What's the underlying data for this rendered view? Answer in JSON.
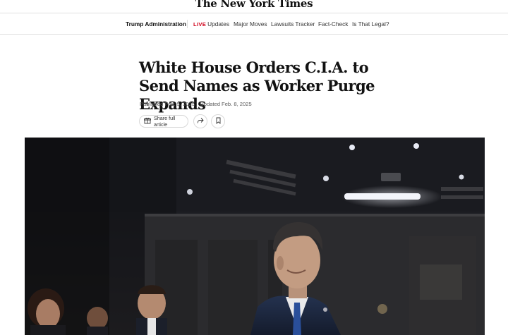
{
  "masthead": {
    "logo_text": "The New York Times"
  },
  "subnav": {
    "section_label": "Trump Administration",
    "live_label": "LIVE",
    "items": [
      "Updates",
      "Major Moves",
      "Lawsuits Tracker",
      "Fact-Check",
      "Is That Legal?"
    ]
  },
  "article": {
    "headline": "White House Orders C.I.A. to Send Names as Worker Purge Expands",
    "published": "Published Feb. 5, 2025",
    "updated": "Updated Feb. 8, 2025"
  },
  "actions": {
    "share_full_label": "Share full article",
    "icons": [
      "gift-icon",
      "share-arrow-icon",
      "bookmark-icon"
    ]
  },
  "colors": {
    "live": "#d0021b",
    "text": "#121212",
    "border": "#dfdfdf"
  }
}
